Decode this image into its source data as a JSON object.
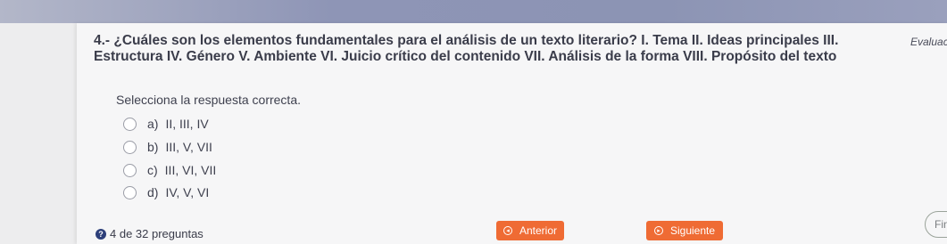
{
  "question": {
    "text": "4.- ¿Cuáles son los elementos fundamentales para el análisis de un texto literario? I. Tema II. Ideas principales III. Estructura IV. Género V. Ambiente VI. Juicio crítico del contenido VII. Análisis de la forma VIII. Propósito del texto",
    "eval_label": "Evaluac"
  },
  "instruction": "Selecciona la respuesta correcta.",
  "options": [
    {
      "letter": "a)",
      "text": "II, III, IV"
    },
    {
      "letter": "b)",
      "text": "III, V, VII"
    },
    {
      "letter": "c)",
      "text": "III, VI, VII"
    },
    {
      "letter": "d)",
      "text": "IV, V, VI"
    }
  ],
  "footer": {
    "count_text": "4 de 32 preguntas",
    "prev_label": "Anterior",
    "next_label": "Siguiente",
    "finish_label": "Fina"
  },
  "colors": {
    "accent": "#ef6b34",
    "top_bar": "#8c94b4"
  },
  "icons": {
    "help": "question-circle-icon",
    "prev": "arrow-left-circle-icon",
    "next": "arrow-right-circle-icon"
  }
}
